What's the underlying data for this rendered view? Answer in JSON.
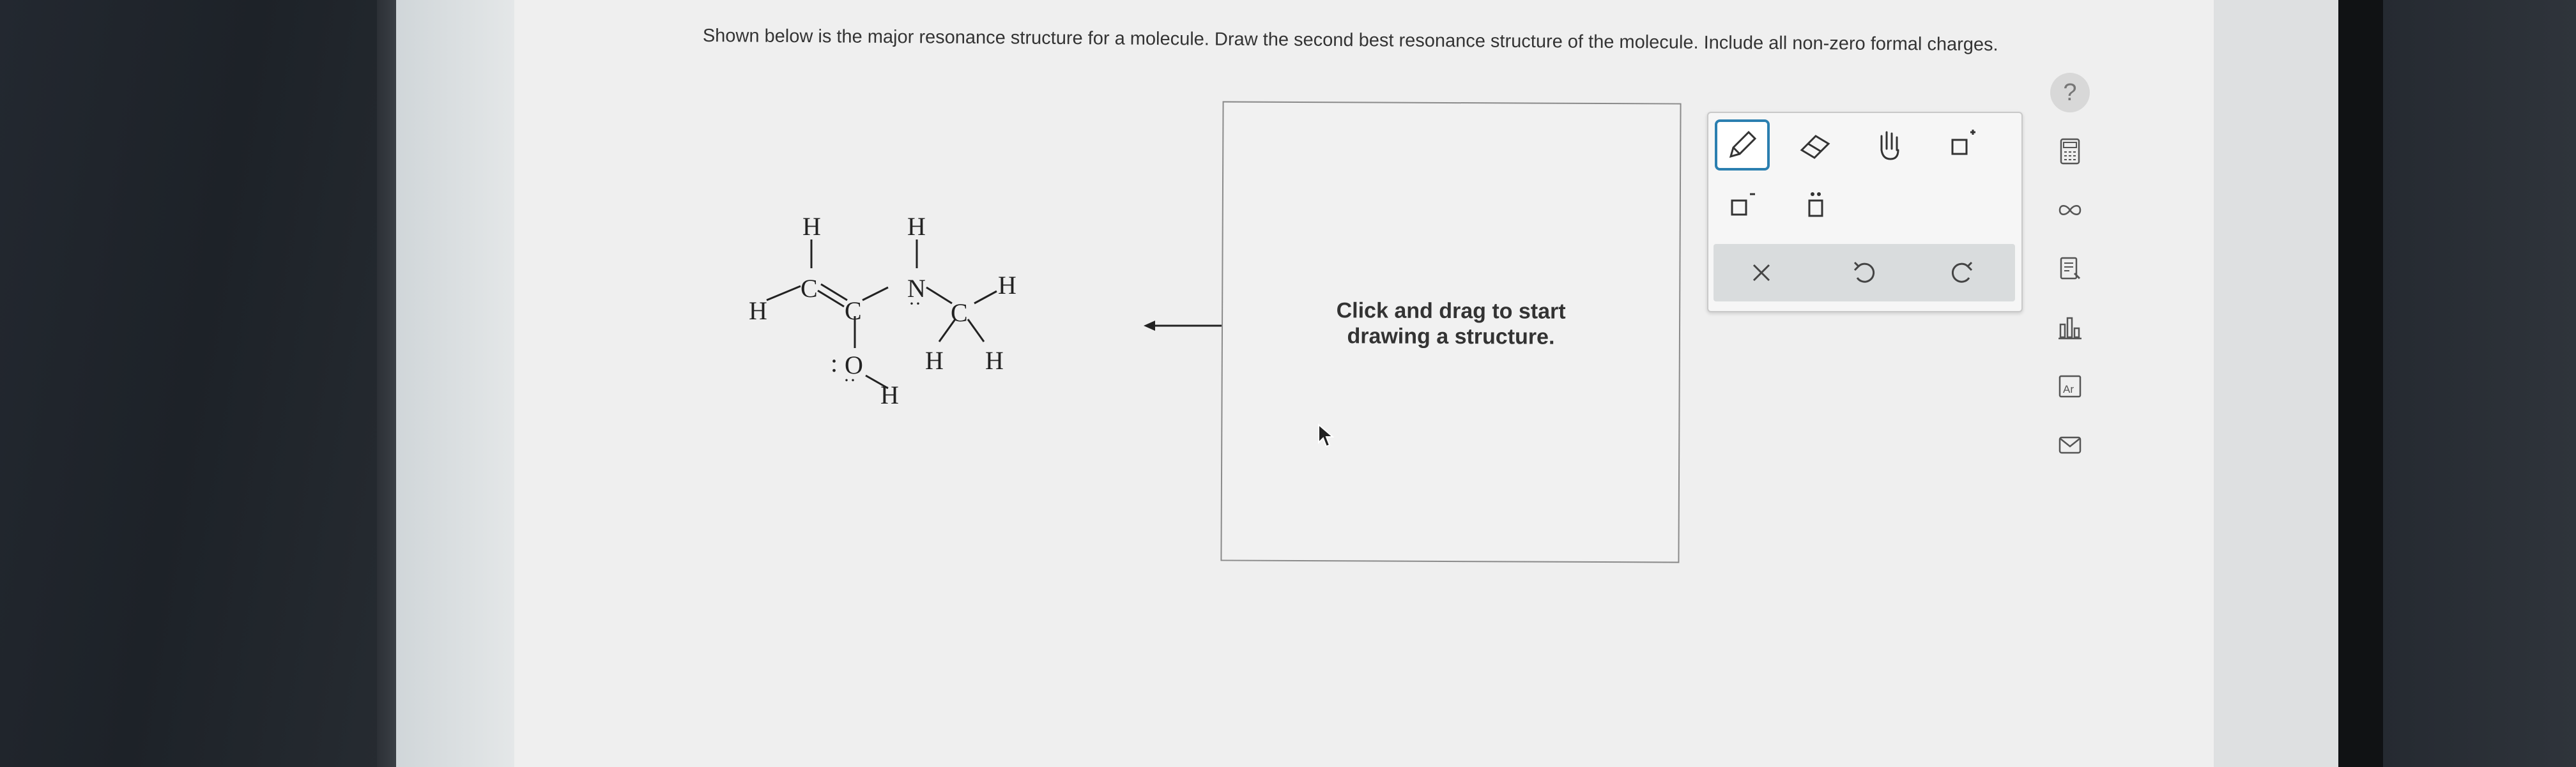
{
  "question": {
    "text": "Shown below is the major resonance structure for a molecule. Draw the second best resonance structure of the molecule. Include all non-zero formal charges."
  },
  "molecule": {
    "atoms": {
      "H_top_c1": "H",
      "C1": "C",
      "H_left": "H",
      "C2": "C",
      "O": "O",
      "H_oh": "H",
      "H_top_n": "H",
      "N": "N",
      "C3": "C",
      "H_right": "H",
      "H_c3_a": "H",
      "H_c3_b": "H"
    },
    "lone_pair_marks": {
      "o_left": ":",
      "n_below": "··",
      "o_below": "··"
    }
  },
  "drawing_area": {
    "hint": "Click and drag to start drawing a structure."
  },
  "toolbar": {
    "tools": [
      "pencil-icon",
      "eraser-icon",
      "hand-icon",
      "positive-charge-icon",
      "negative-charge-icon",
      "lone-pair-icon",
      "clear-icon",
      "undo-icon",
      "redo-icon"
    ]
  },
  "sidebar": {
    "help_label": "?",
    "items": [
      "calculator-icon",
      "infinity-icon",
      "notes-icon",
      "bar-chart-icon",
      "periodic-table-icon",
      "mail-icon"
    ],
    "periodic_label": "Ar"
  },
  "colors": {
    "accent": "#2b7fb0",
    "text": "#333333",
    "content_bg": "#efefef"
  }
}
